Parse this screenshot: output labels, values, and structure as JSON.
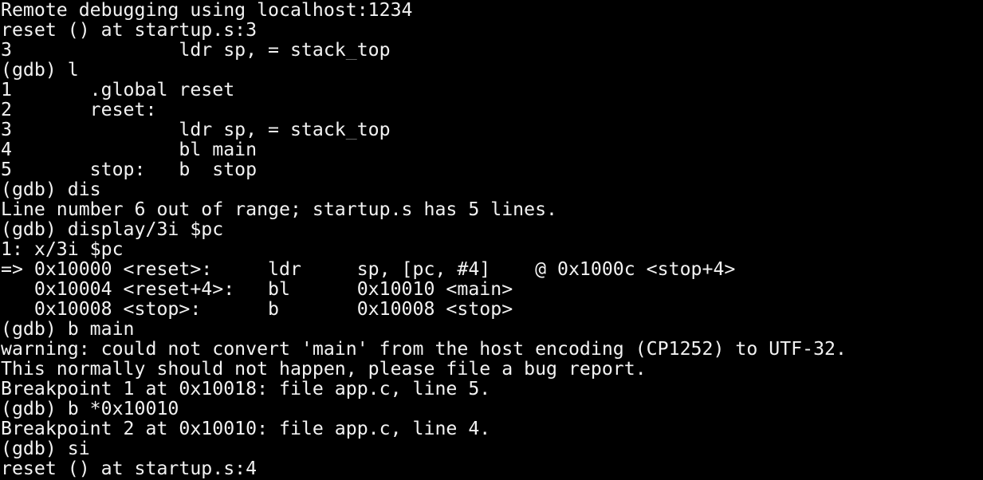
{
  "terminal": {
    "background": "#000000",
    "foreground": "#f2f2f2",
    "lines": [
      "Remote debugging using localhost:1234",
      "reset () at startup.s:3",
      "3               ldr sp, = stack_top",
      "(gdb) l",
      "1       .global reset",
      "2       reset:",
      "3               ldr sp, = stack_top",
      "4               bl main",
      "5       stop:   b  stop",
      "(gdb) dis",
      "Line number 6 out of range; startup.s has 5 lines.",
      "(gdb) display/3i $pc",
      "1: x/3i $pc",
      "=> 0x10000 <reset>:     ldr     sp, [pc, #4]    @ 0x1000c <stop+4>",
      "   0x10004 <reset+4>:   bl      0x10010 <main>",
      "   0x10008 <stop>:      b       0x10008 <stop>",
      "(gdb) b main",
      "warning: could not convert 'main' from the host encoding (CP1252) to UTF-32.",
      "This normally should not happen, please file a bug report.",
      "Breakpoint 1 at 0x10018: file app.c, line 5.",
      "(gdb) b *0x10010",
      "Breakpoint 2 at 0x10010: file app.c, line 4.",
      "(gdb) si",
      "reset () at startup.s:4"
    ]
  }
}
